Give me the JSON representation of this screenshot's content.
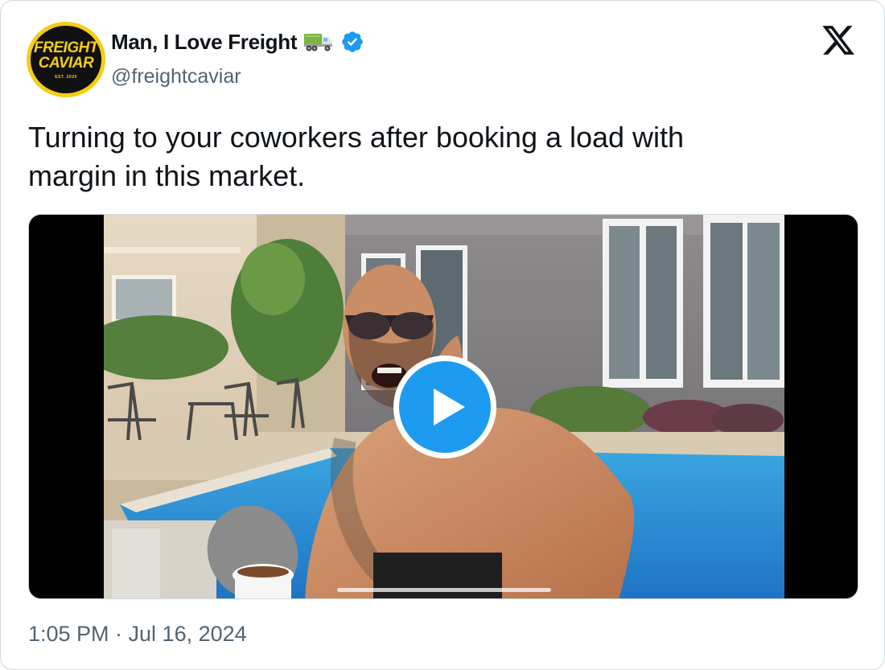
{
  "tweet": {
    "author": {
      "display_name": "Man, I Love Freight",
      "handle": "@freightcaviar",
      "avatar_text": [
        "FREIGHT",
        "CAVIAR",
        "EST. 2020"
      ],
      "emoji_icon": "truck-icon",
      "verified_icon": "verified-badge-icon"
    },
    "text": "Turning to your coworkers after booking a load with\nmargin in this market.",
    "media": {
      "type": "video",
      "overlay_icon": "play-icon"
    },
    "timestamp": "1:05 PM · Jul 16, 2024",
    "platform_icon": "x-logo-icon"
  },
  "colors": {
    "text_primary": "#0f1419",
    "text_secondary": "#536471",
    "accent_blue": "#1d9bf0",
    "avatar_yellow": "#f5cd14",
    "border": "#cfd9de"
  }
}
